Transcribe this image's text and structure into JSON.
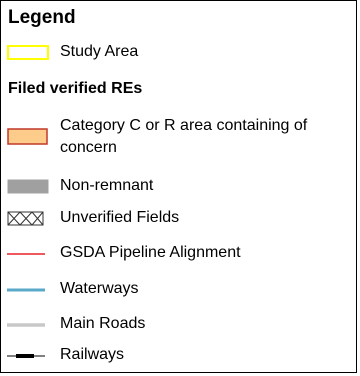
{
  "legend": {
    "title": "Legend",
    "items": [
      {
        "label": "Study Area",
        "icon": "yellow-outline-box-icon",
        "color": "#FFFF00"
      },
      {
        "section_title": "Filed verified REs"
      },
      {
        "label": "Category C or R area containing of concern",
        "icon": "orange-fill-box-icon",
        "fill": "#FDCB8A",
        "stroke": "#C0392B"
      },
      {
        "label": "Non-remnant",
        "icon": "grey-fill-box-icon",
        "fill": "#A0A0A0"
      },
      {
        "label": "Unverified Fields",
        "icon": "crosshatch-box-icon",
        "stroke": "#333333"
      },
      {
        "label": "GSDA Pipeline Alignment",
        "icon": "red-line-icon",
        "color": "#E8202A"
      },
      {
        "label": "Waterways",
        "icon": "blue-line-icon",
        "color": "#5AA9C8"
      },
      {
        "label": "Main Roads",
        "icon": "grey-line-icon",
        "color": "#C8C8C8"
      },
      {
        "label": "Railways",
        "icon": "railway-line-icon",
        "color": "#000000"
      }
    ]
  }
}
